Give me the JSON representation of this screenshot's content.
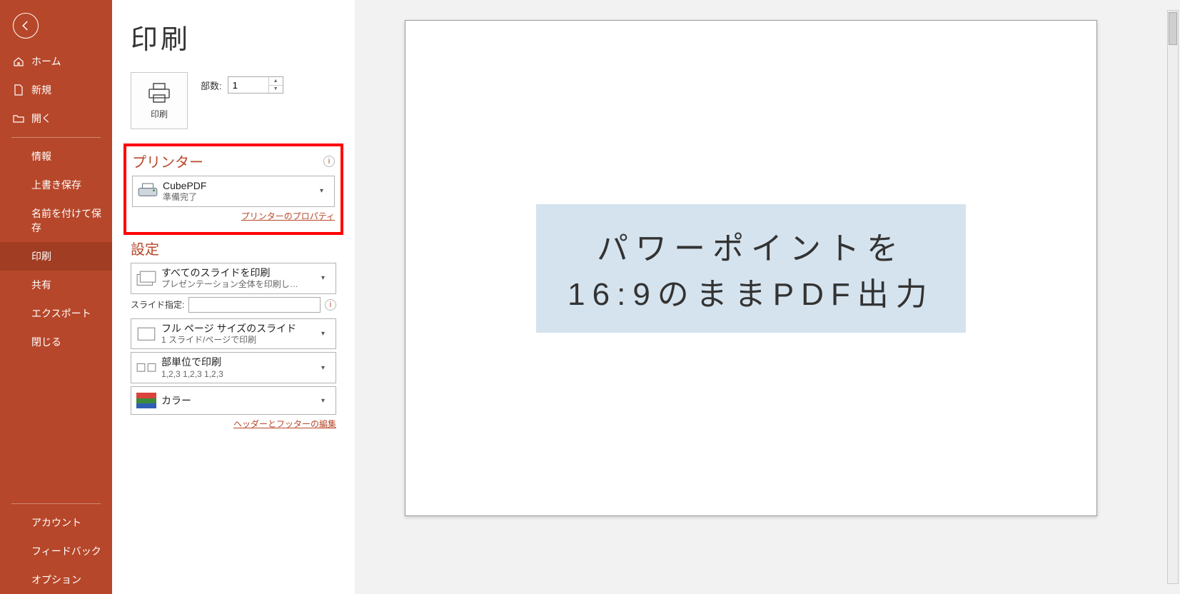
{
  "sidebar": {
    "home": "ホーム",
    "new": "新規",
    "open": "開く",
    "info": "情報",
    "save": "上書き保存",
    "saveAs": "名前を付けて保存",
    "print": "印刷",
    "share": "共有",
    "export": "エクスポート",
    "close": "閉じる",
    "account": "アカウント",
    "feedback": "フィードバック",
    "options": "オプション"
  },
  "page": {
    "title": "印刷",
    "printBtn": "印刷",
    "copiesLabel": "部数:",
    "copiesValue": "1"
  },
  "printer": {
    "sectionTitle": "プリンター",
    "name": "CubePDF",
    "status": "準備完了",
    "propertiesLink": "プリンターのプロパティ"
  },
  "settings": {
    "sectionTitle": "設定",
    "rangeTitle": "すべてのスライドを印刷",
    "rangeSub": "プレゼンテーション全体を印刷し…",
    "slideSpecLabel": "スライド指定:",
    "slideSpecValue": "",
    "layoutTitle": "フル ページ サイズのスライド",
    "layoutSub": "1 スライド/ページで印刷",
    "collateTitle": "部単位で印刷",
    "collateSub": "1,2,3   1,2,3   1,2,3",
    "colorTitle": "カラー",
    "headerFooterLink": "ヘッダーとフッターの編集"
  },
  "slide": {
    "line1": "パワーポイントを",
    "line2": "16:9のままPDF出力"
  }
}
